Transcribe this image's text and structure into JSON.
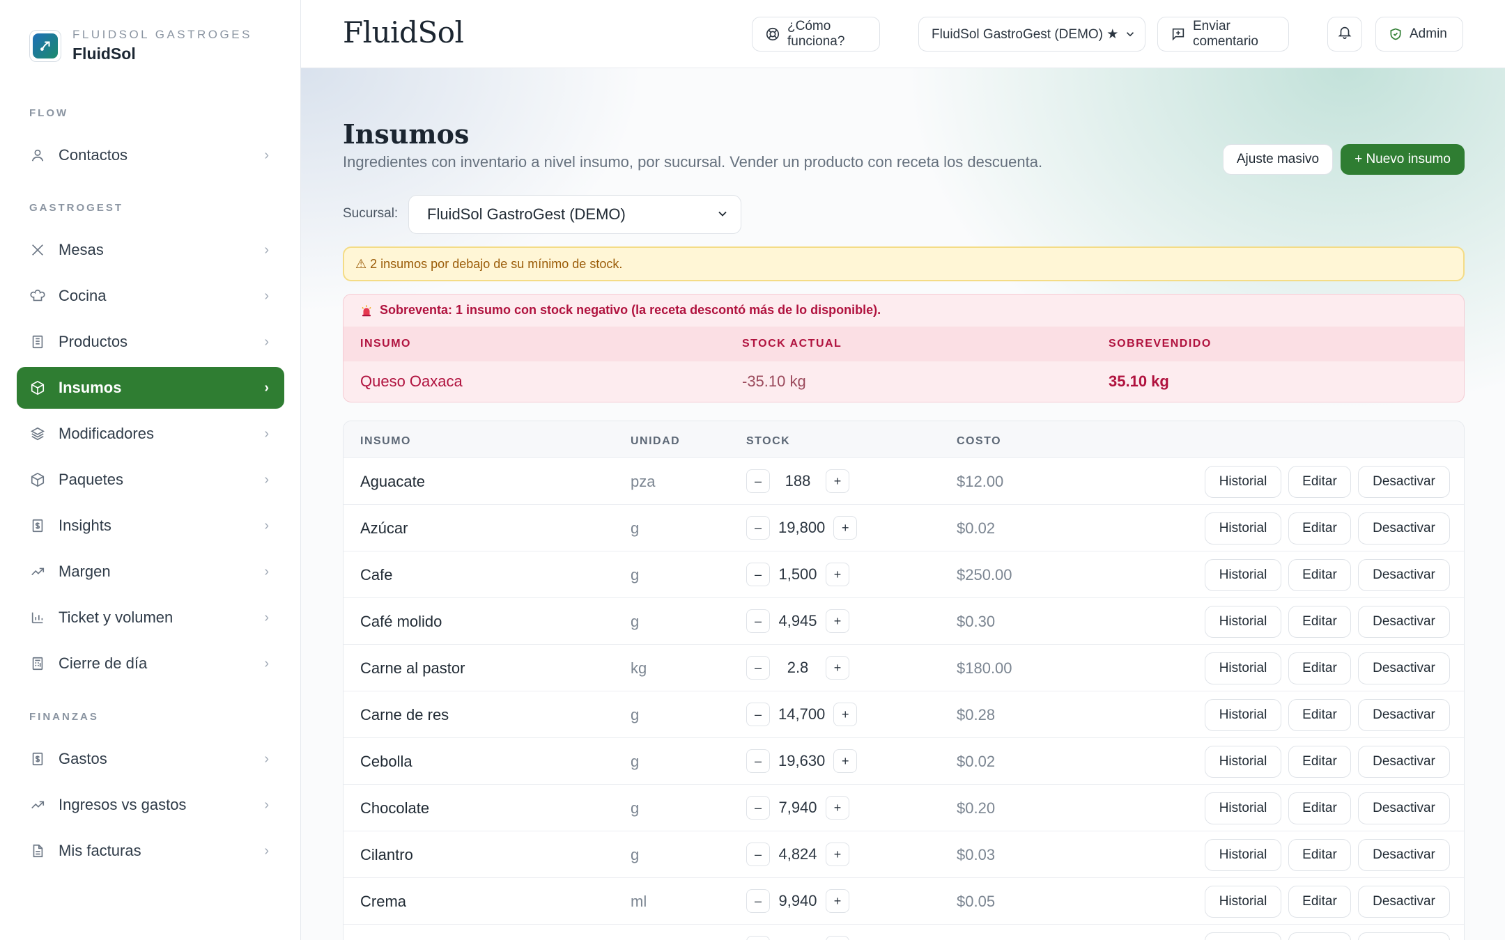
{
  "sidebar": {
    "org": "FLUIDSOL GASTROGES",
    "brand": "FluidSol",
    "sections": [
      {
        "label": "FLOW",
        "items": [
          {
            "label": "Contactos",
            "icon": "user-icon"
          }
        ]
      },
      {
        "label": "GASTROGEST",
        "items": [
          {
            "label": "Mesas",
            "icon": "utensils-icon"
          },
          {
            "label": "Cocina",
            "icon": "chef-hat-icon"
          },
          {
            "label": "Productos",
            "icon": "store-icon"
          },
          {
            "label": "Insumos",
            "icon": "package-icon",
            "active": true
          },
          {
            "label": "Modificadores",
            "icon": "layers-icon"
          },
          {
            "label": "Paquetes",
            "icon": "box-icon"
          },
          {
            "label": "Insights",
            "icon": "dollar-doc-icon"
          },
          {
            "label": "Margen",
            "icon": "trend-up-icon"
          },
          {
            "label": "Ticket y volumen",
            "icon": "bar-chart-icon"
          },
          {
            "label": "Cierre de día",
            "icon": "calculator-icon"
          }
        ]
      },
      {
        "label": "FINANZAS",
        "items": [
          {
            "label": "Gastos",
            "icon": "dollar-doc-icon"
          },
          {
            "label": "Ingresos vs gastos",
            "icon": "trend-up-icon"
          },
          {
            "label": "Mis facturas",
            "icon": "file-icon"
          }
        ]
      }
    ]
  },
  "topbar": {
    "title": "FluidSol",
    "help": "¿Cómo funciona?",
    "branch": "FluidSol GastroGest (DEMO) ★",
    "feedback": "Enviar comentario",
    "admin": "Admin"
  },
  "page": {
    "title": "Insumos",
    "subtitle": "Ingredientes con inventario a nivel insumo, por sucursal. Vender un producto con receta los descuenta.",
    "bulk_adjust": "Ajuste masivo",
    "new_item": "+ Nuevo insumo",
    "branch_label": "Sucursal:",
    "branch_value": "FluidSol GastroGest (DEMO)",
    "warning": "⚠ 2 insumos por debajo de su mínimo de stock."
  },
  "oversold": {
    "header": "Sobreventa: 1 insumo con stock negativo (la receta descontó más de lo disponible).",
    "columns": [
      "INSUMO",
      "STOCK ACTUAL",
      "SOBREVENDIDO"
    ],
    "row": {
      "name": "Queso Oaxaca",
      "stock": "-35.10 kg",
      "oversold": "35.10 kg"
    }
  },
  "table": {
    "columns": [
      "INSUMO",
      "UNIDAD",
      "STOCK",
      "COSTO"
    ],
    "actions": {
      "history": "Historial",
      "edit": "Editar",
      "deactivate": "Desactivar"
    },
    "step_minus": "–",
    "step_plus": "+",
    "rows": [
      {
        "name": "Aguacate",
        "unit": "pza",
        "stock": "188",
        "cost": "$12.00"
      },
      {
        "name": "Azúcar",
        "unit": "g",
        "stock": "19,800",
        "cost": "$0.02"
      },
      {
        "name": "Cafe",
        "unit": "g",
        "stock": "1,500",
        "cost": "$250.00"
      },
      {
        "name": "Café molido",
        "unit": "g",
        "stock": "4,945",
        "cost": "$0.30"
      },
      {
        "name": "Carne al pastor",
        "unit": "kg",
        "stock": "2.8",
        "cost": "$180.00"
      },
      {
        "name": "Carne de res",
        "unit": "g",
        "stock": "14,700",
        "cost": "$0.28"
      },
      {
        "name": "Cebolla",
        "unit": "g",
        "stock": "19,630",
        "cost": "$0.02"
      },
      {
        "name": "Chocolate",
        "unit": "g",
        "stock": "7,940",
        "cost": "$0.20"
      },
      {
        "name": "Cilantro",
        "unit": "g",
        "stock": "4,824",
        "cost": "$0.03"
      },
      {
        "name": "Crema",
        "unit": "ml",
        "stock": "9,940",
        "cost": "$0.05"
      },
      {
        "name": "",
        "unit": "",
        "stock": "",
        "cost": ""
      }
    ]
  },
  "colors": {
    "accent": "#2f7d32",
    "danger": "#b0123e",
    "warning": "#9a5b07"
  }
}
